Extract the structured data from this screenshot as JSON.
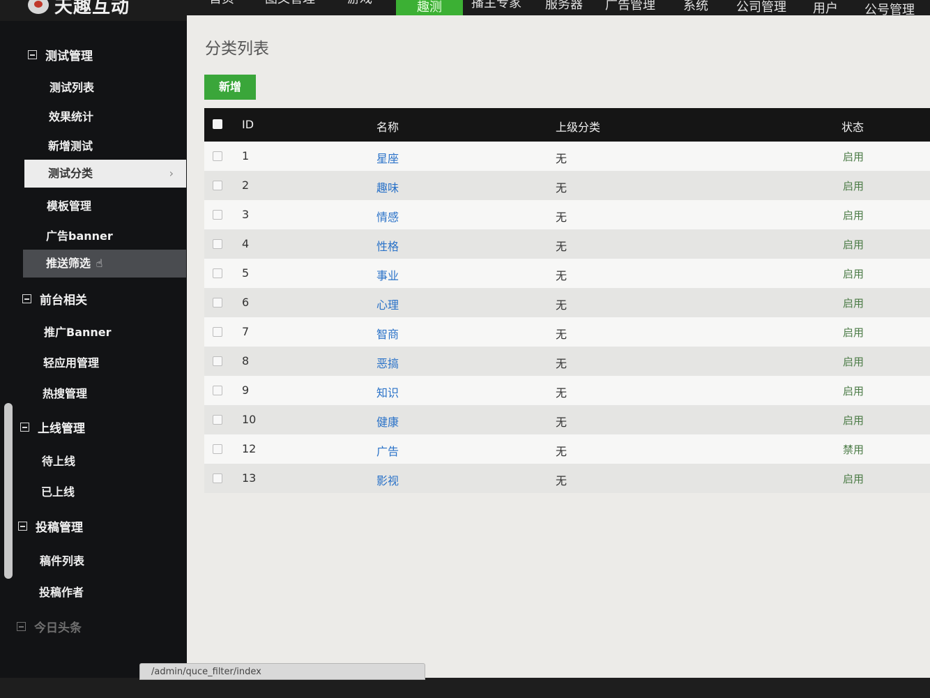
{
  "brand": {
    "logo_text": "天趣互动"
  },
  "topnav": [
    {
      "label": "首页"
    },
    {
      "label": "图文管理"
    },
    {
      "label": "游戏"
    },
    {
      "label": "趣测",
      "active": true
    },
    {
      "label": "播主专家"
    },
    {
      "label": "服务器"
    },
    {
      "label": "广告管理"
    },
    {
      "label": "系统"
    },
    {
      "label": "公司管理"
    },
    {
      "label": "用户"
    },
    {
      "label": "公号管理"
    }
  ],
  "sidebar": {
    "groups": [
      {
        "title": "测试管理",
        "items": [
          "测试列表",
          "效果统计",
          "新增测试",
          "测试分类",
          "模板管理",
          "广告banner",
          "推送筛选"
        ]
      },
      {
        "title": "前台相关",
        "items": [
          "推广Banner",
          "轻应用管理",
          "热搜管理"
        ]
      },
      {
        "title": "上线管理",
        "items": [
          "待上线",
          "已上线"
        ]
      },
      {
        "title": "投稿管理",
        "items": [
          "稿件列表",
          "投稿作者"
        ]
      },
      {
        "title": "今日头条",
        "items": []
      }
    ],
    "active_item": "测试分类",
    "hover_item": "推送筛选"
  },
  "main": {
    "title": "分类列表",
    "add_button": "新增",
    "columns": {
      "id": "ID",
      "name": "名称",
      "parent": "上级分类",
      "status": "状态"
    },
    "rows": [
      {
        "id": "1",
        "name": "星座",
        "parent": "无",
        "status": "启用"
      },
      {
        "id": "2",
        "name": "趣味",
        "parent": "无",
        "status": "启用"
      },
      {
        "id": "3",
        "name": "情感",
        "parent": "无",
        "status": "启用"
      },
      {
        "id": "4",
        "name": "性格",
        "parent": "无",
        "status": "启用"
      },
      {
        "id": "5",
        "name": "事业",
        "parent": "无",
        "status": "启用"
      },
      {
        "id": "6",
        "name": "心理",
        "parent": "无",
        "status": "启用"
      },
      {
        "id": "7",
        "name": "智商",
        "parent": "无",
        "status": "启用"
      },
      {
        "id": "8",
        "name": "恶搞",
        "parent": "无",
        "status": "启用"
      },
      {
        "id": "9",
        "name": "知识",
        "parent": "无",
        "status": "启用"
      },
      {
        "id": "10",
        "name": "健康",
        "parent": "无",
        "status": "启用"
      },
      {
        "id": "12",
        "name": "广告",
        "parent": "无",
        "status": "禁用"
      },
      {
        "id": "13",
        "name": "影视",
        "parent": "无",
        "status": "启用"
      }
    ]
  },
  "statusbar": {
    "url": "/admin/quce_filter/index"
  },
  "colors": {
    "accent_green": "#3aa63a",
    "link_blue": "#2a72c8",
    "sidebar_bg": "#121315"
  }
}
